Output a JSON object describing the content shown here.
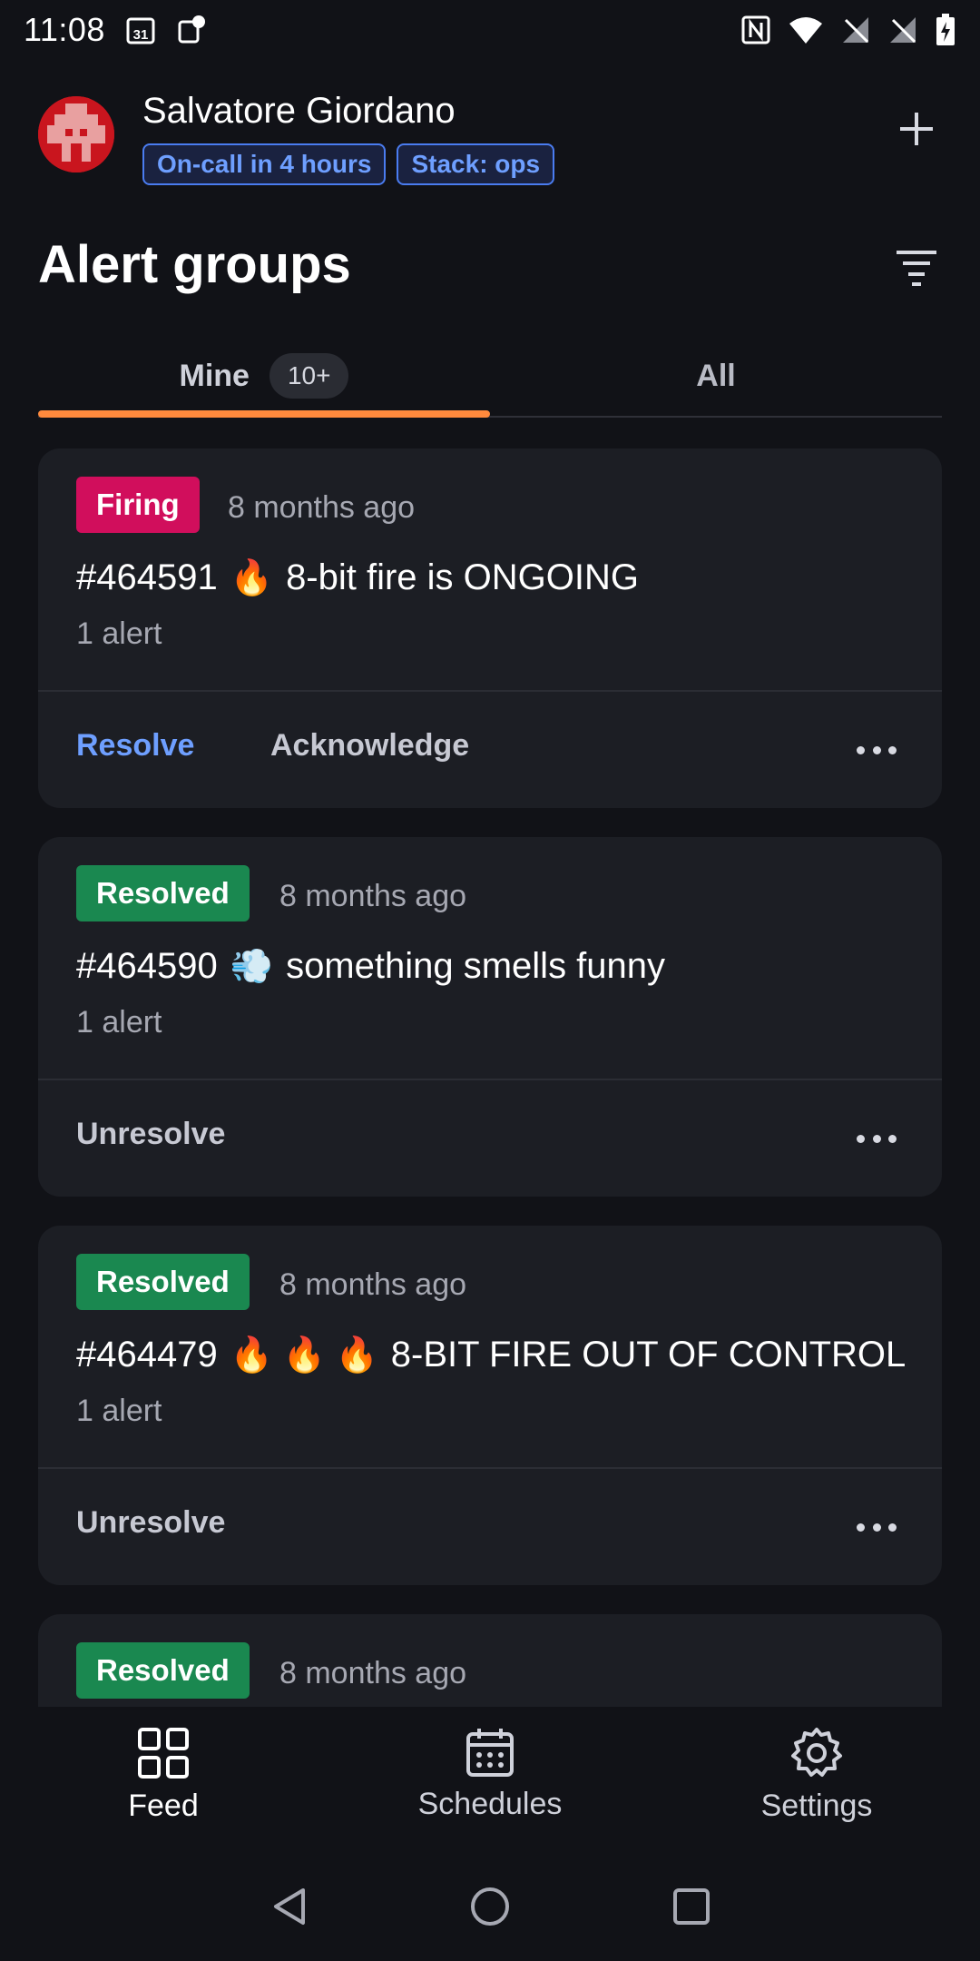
{
  "status_bar": {
    "time": "11:08",
    "calendar_day": "31",
    "left_icons": [
      "calendar-icon",
      "notification-icon"
    ],
    "right_icons": [
      "nfc-icon",
      "wifi-icon",
      "signal-off-icon",
      "signal-off-icon",
      "battery-charging-icon"
    ]
  },
  "header": {
    "user_name": "Salvatore Giordano",
    "badges": [
      "On-call in 4 hours",
      "Stack: ops"
    ],
    "add_icon": "plus-icon"
  },
  "title": {
    "text": "Alert groups",
    "filter_icon": "filter-icon"
  },
  "tabs": [
    {
      "label": "Mine",
      "count": "10+",
      "active": true
    },
    {
      "label": "All",
      "active": false
    }
  ],
  "alert_groups": [
    {
      "status": "Firing",
      "status_color": "#d10e5c",
      "time": "8 months ago",
      "id": "#464591",
      "emoji": "🔥",
      "title": "8-bit fire is ONGOING",
      "alert_count": "1 alert",
      "actions": [
        "Resolve",
        "Acknowledge"
      ]
    },
    {
      "status": "Resolved",
      "status_color": "#1a8850",
      "time": "8 months ago",
      "id": "#464590",
      "emoji": "💨",
      "title": "something smells funny",
      "alert_count": "1 alert",
      "actions": [
        "Unresolve"
      ]
    },
    {
      "status": "Resolved",
      "status_color": "#1a8850",
      "time": "8 months ago",
      "id": "#464479",
      "emoji": "🔥 🔥 🔥",
      "title": "8-BIT FIRE OUT OF CONTROL",
      "alert_count": "1 alert",
      "actions": [
        "Unresolve"
      ]
    },
    {
      "status": "Resolved",
      "status_color": "#1a8850",
      "time": "8 months ago"
    }
  ],
  "bottom_nav": [
    {
      "label": "Feed",
      "icon": "grid-icon",
      "active": true
    },
    {
      "label": "Schedules",
      "icon": "calendar-icon",
      "active": false
    },
    {
      "label": "Settings",
      "icon": "gear-icon",
      "active": false
    }
  ],
  "system_nav": [
    "back-icon",
    "home-icon",
    "recents-icon"
  ],
  "colors": {
    "background": "#111217",
    "card": "#1c1e24",
    "accent_blue": "#6e9fff",
    "tab_indicator": "#ff8a3d",
    "firing": "#d10e5c",
    "resolved": "#1a8850"
  }
}
